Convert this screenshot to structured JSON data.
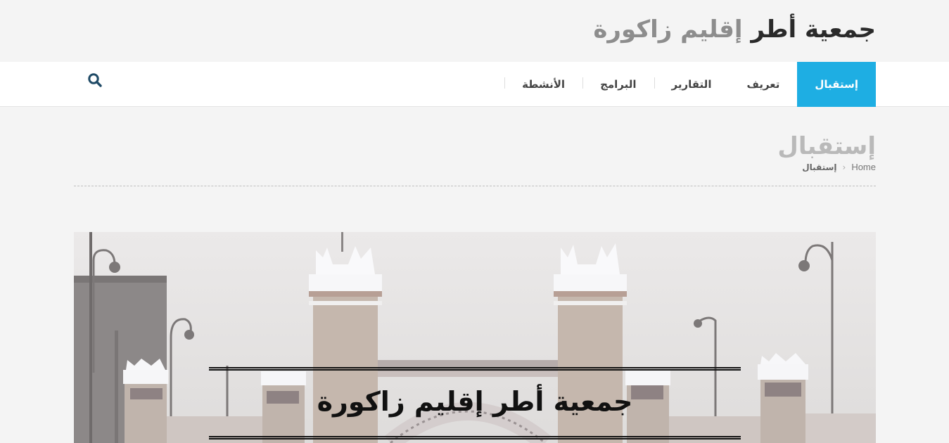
{
  "header": {
    "title_dark": "جمعية أطر",
    "title_light": "إقليم زاكورة"
  },
  "nav": {
    "items": [
      {
        "label": "إستقبال",
        "active": true
      },
      {
        "label": "تعريف",
        "active": false
      },
      {
        "label": "التقارير",
        "active": false
      },
      {
        "label": "البرامج",
        "active": false
      },
      {
        "label": "الأنشطة",
        "active": false
      }
    ],
    "search_icon": "search-icon"
  },
  "page": {
    "heading": "إستقبال",
    "breadcrumb": {
      "home": "Home",
      "separator": "›",
      "current": "إستقبال"
    }
  },
  "hero": {
    "title": "جمعية أطر إقليم زاكورة",
    "image": "zagora-city-gate-photo"
  },
  "colors": {
    "accent": "#1eaee3",
    "title_dark": "#2a2a2a",
    "title_light": "#8d8d8d",
    "search_icon": "#1f4a66"
  }
}
